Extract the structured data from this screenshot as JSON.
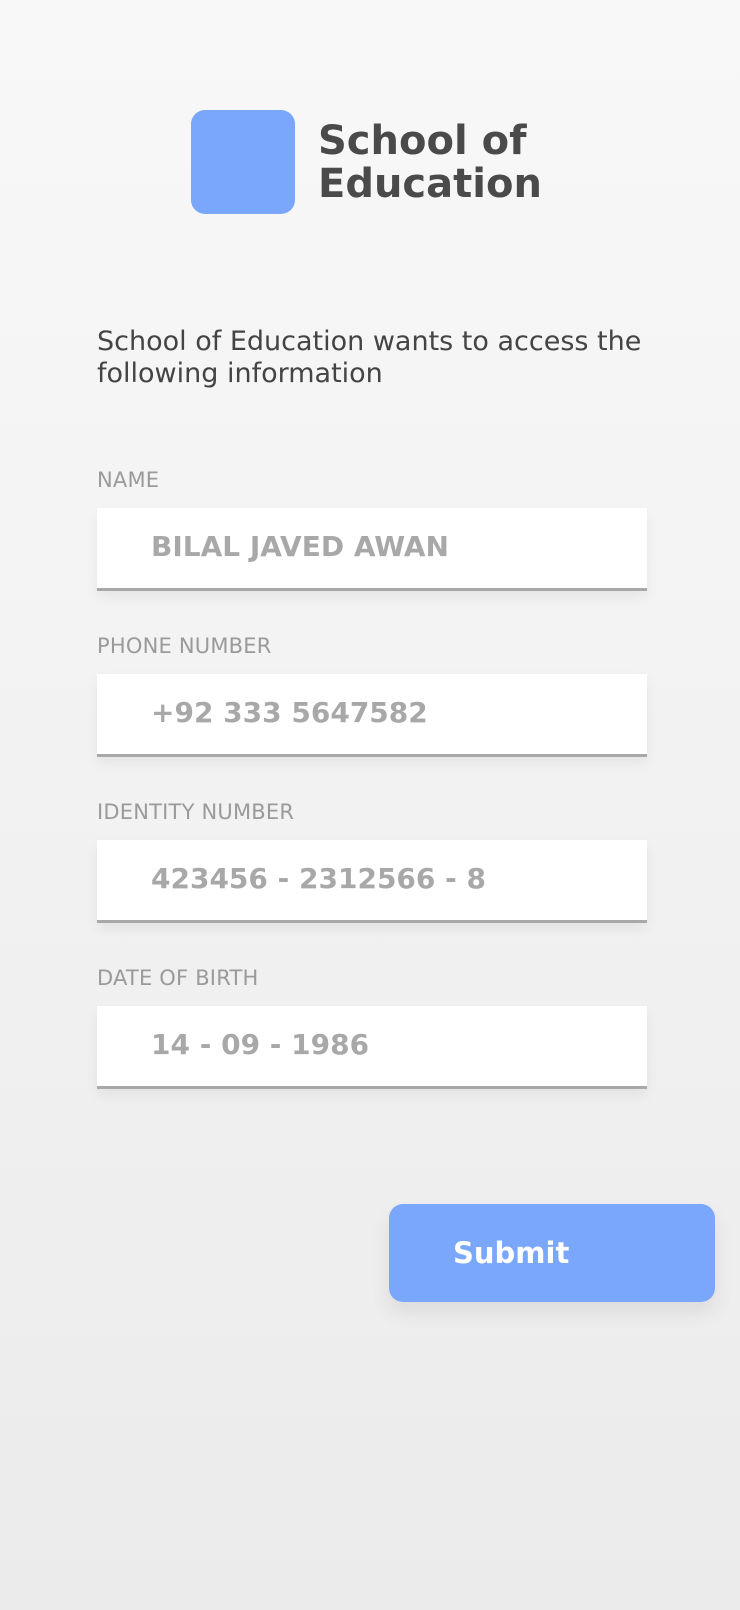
{
  "header": {
    "logo_icon": "square-logo",
    "title_line1": "School of",
    "title_line2": "Education"
  },
  "intro_text": "School of Education wants to access the following information",
  "fields": [
    {
      "label": "NAME",
      "value": "BILAL JAVED AWAN"
    },
    {
      "label": "PHONE NUMBER",
      "value": "+92 333 5647582"
    },
    {
      "label": "IDENTITY NUMBER",
      "value": "423456 - 2312566 - 8"
    },
    {
      "label": "DATE OF BIRTH",
      "value": "14 - 09 - 1986"
    }
  ],
  "submit_label": "Submit",
  "colors": {
    "accent": "#7aa7fc",
    "label_gray": "#9a9a9a",
    "value_gray": "#a8a8a8",
    "title_dark": "#4a4a4a"
  }
}
